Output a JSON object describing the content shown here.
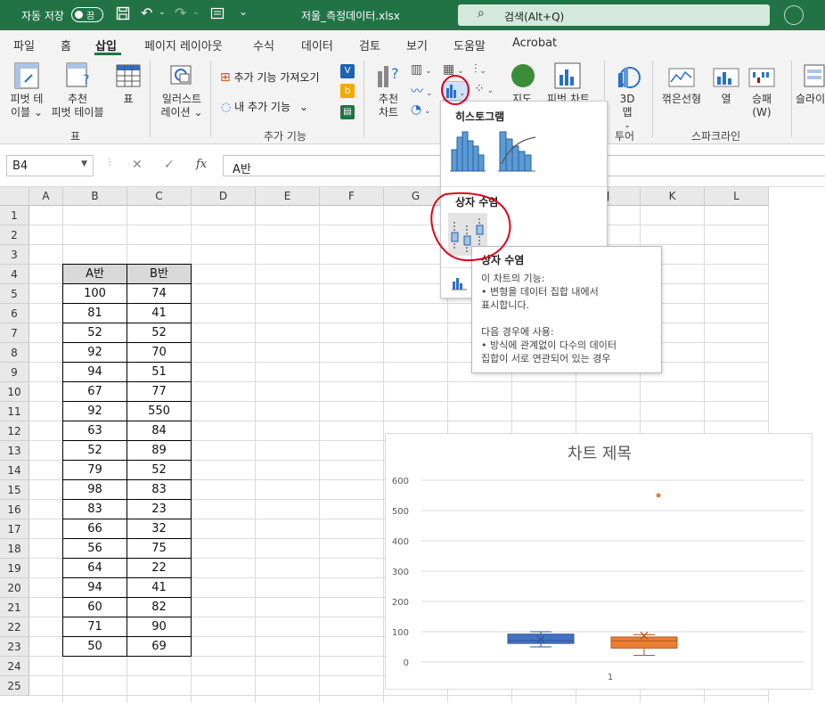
{
  "titlebar": {
    "autosave_label": "자동 저장",
    "autosave_state": "끔",
    "filename": "저울_측정데이터.xlsx",
    "search_placeholder": "검색(Alt+Q)"
  },
  "menu": {
    "tabs": [
      "파일",
      "홈",
      "삽입",
      "페이지 레이아웃",
      "수식",
      "데이터",
      "검토",
      "보기",
      "도움말",
      "Acrobat"
    ],
    "active": "삽입"
  },
  "ribbon": {
    "pivot_table": [
      "피벗 테",
      "이블"
    ],
    "recommended_pivot": [
      "추천",
      "피벗 테이블"
    ],
    "table": "표",
    "group_tables": "표",
    "illustrations": [
      "일러스트",
      "레이션"
    ],
    "get_addins": "추가 기능 가져오기",
    "my_addins": "내 추가 기능",
    "group_addins": "추가 기능",
    "recommended_charts": [
      "추천",
      "차트"
    ],
    "maps": "지도",
    "pivot_chart": "피벗 차트",
    "map_3d": [
      "3D",
      "맵"
    ],
    "group_tours": "투어",
    "sparkline_line": "꺾은선형",
    "sparkline_column": "열",
    "sparkline_winloss": [
      "승패",
      "(W)"
    ],
    "group_sparklines": "스파크라인",
    "slicer": "슬라이"
  },
  "formula_bar": {
    "name_box": "B4",
    "fx": "fx",
    "content": "A반"
  },
  "sheet": {
    "columns": [
      "A",
      "B",
      "C",
      "D",
      "E",
      "F",
      "G",
      "H",
      "I",
      "J",
      "K",
      "L"
    ],
    "rows": [
      "1",
      "2",
      "3",
      "4",
      "5",
      "6",
      "7",
      "8",
      "9",
      "10",
      "11",
      "12",
      "13",
      "14",
      "15",
      "16",
      "17",
      "18",
      "19",
      "20",
      "21",
      "22",
      "23",
      "24",
      "25"
    ],
    "table_headers": [
      "A반",
      "B반"
    ],
    "table_rows": [
      [
        "100",
        "74"
      ],
      [
        "81",
        "41"
      ],
      [
        "52",
        "52"
      ],
      [
        "92",
        "70"
      ],
      [
        "94",
        "51"
      ],
      [
        "67",
        "77"
      ],
      [
        "92",
        "550"
      ],
      [
        "63",
        "84"
      ],
      [
        "52",
        "89"
      ],
      [
        "79",
        "52"
      ],
      [
        "98",
        "83"
      ],
      [
        "83",
        "23"
      ],
      [
        "66",
        "32"
      ],
      [
        "56",
        "75"
      ],
      [
        "64",
        "22"
      ],
      [
        "94",
        "41"
      ],
      [
        "60",
        "82"
      ],
      [
        "71",
        "90"
      ],
      [
        "50",
        "69"
      ]
    ]
  },
  "dropdown": {
    "histogram_title": "히스토그램",
    "boxwhisker_title": "상자 수염"
  },
  "tooltip": {
    "title": "상자 수염",
    "lines": [
      "이 차트의 기능:",
      "• 변형을 데이터 집합 내에서",
      "표시합니다.",
      "",
      "다음 경우에 사용:",
      "• 방식에 관계없이 다수의 데이터",
      "집합이 서로 연관되어 있는 경우"
    ]
  },
  "colors": {
    "excel_green": "#217346",
    "series_a": "#4472C4",
    "series_b": "#ED7D31",
    "annotation": "#E0001B"
  },
  "chart_data": {
    "type": "box",
    "title": "차트 제목",
    "categories": [
      "1"
    ],
    "ylim": [
      0,
      600
    ],
    "yticks": [
      0,
      100,
      200,
      300,
      400,
      500,
      600
    ],
    "grid": true,
    "series": [
      {
        "values": [
          100,
          81,
          52,
          92,
          94,
          67,
          92,
          63,
          52,
          79,
          98,
          83,
          66,
          56,
          64,
          94,
          60,
          71,
          50
        ],
        "color": "#4472C4"
      },
      {
        "values": [
          74,
          41,
          52,
          70,
          51,
          77,
          550,
          84,
          89,
          52,
          83,
          23,
          32,
          75,
          22,
          41,
          82,
          90,
          69
        ],
        "color": "#ED7D31"
      }
    ]
  }
}
